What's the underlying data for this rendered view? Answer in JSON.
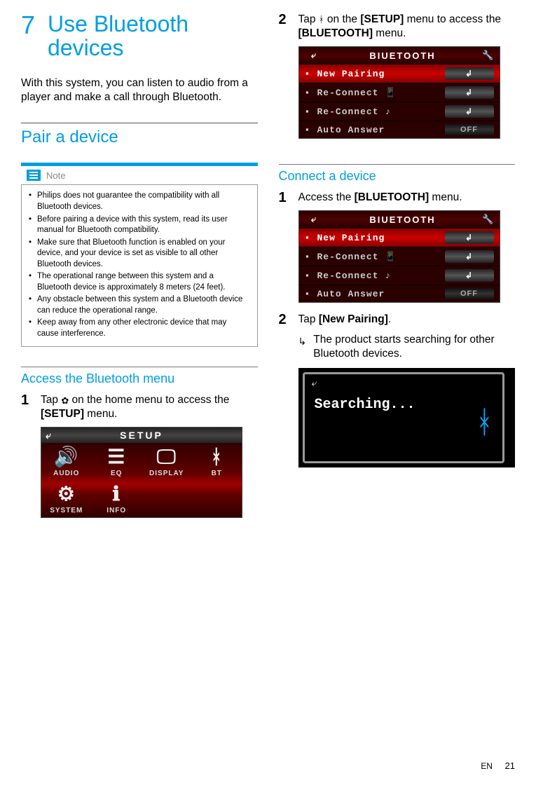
{
  "chapter": {
    "num": "7",
    "title": "Use Bluetooth devices"
  },
  "intro": "With this system, you can listen to audio from a player and make a call through Bluetooth.",
  "pair": {
    "heading": "Pair a device"
  },
  "note": {
    "label": "Note",
    "items": [
      "Philips does not guarantee the compatibility with all Bluetooth devices.",
      "Before pairing a device with this system, read its user manual for Bluetooth compatibility.",
      "Make sure that Bluetooth function is enabled on your device, and your device is set as visible to all other Bluetooth devices.",
      "The operational range between this system and a Bluetooth device is approximately 8 meters (24 feet).",
      "Any obstacle between this system and a Bluetooth device can reduce the operational range.",
      "Keep away from any other electronic device that may cause interference."
    ]
  },
  "access": {
    "heading": "Access the Bluetooth menu",
    "step1_a": "Tap ",
    "step1_b": " on the home menu to access the ",
    "step1_bold": "[SETUP]",
    "step1_c": " menu.",
    "step2_a": "Tap ",
    "step2_b": " on the ",
    "step2_bold1": "[SETUP]",
    "step2_c": " menu to access the ",
    "step2_bold2": "[BLUETOOTH]",
    "step2_d": " menu."
  },
  "setup_screen": {
    "title": "SETUP",
    "cells": [
      "AUDIO",
      "EQ",
      "DISPLAY",
      "BT",
      "SYSTEM",
      "INFO"
    ]
  },
  "bt_screen": {
    "title": "BIUETOOTH",
    "rows": [
      "New Pairing",
      "Re-Connect",
      "Re-Connect",
      "Auto Answer"
    ],
    "off": "OFF"
  },
  "connect": {
    "heading": "Connect a device",
    "step1_a": "Access the ",
    "step1_bold": "[BLUETOOTH]",
    "step1_b": " menu.",
    "step2_a": "Tap ",
    "step2_bold": "[New Pairing]",
    "step2_b": ".",
    "result": "The product starts searching for other Bluetooth devices."
  },
  "searching": {
    "text": "Searching..."
  },
  "footer": {
    "lang": "EN",
    "page": "21"
  }
}
